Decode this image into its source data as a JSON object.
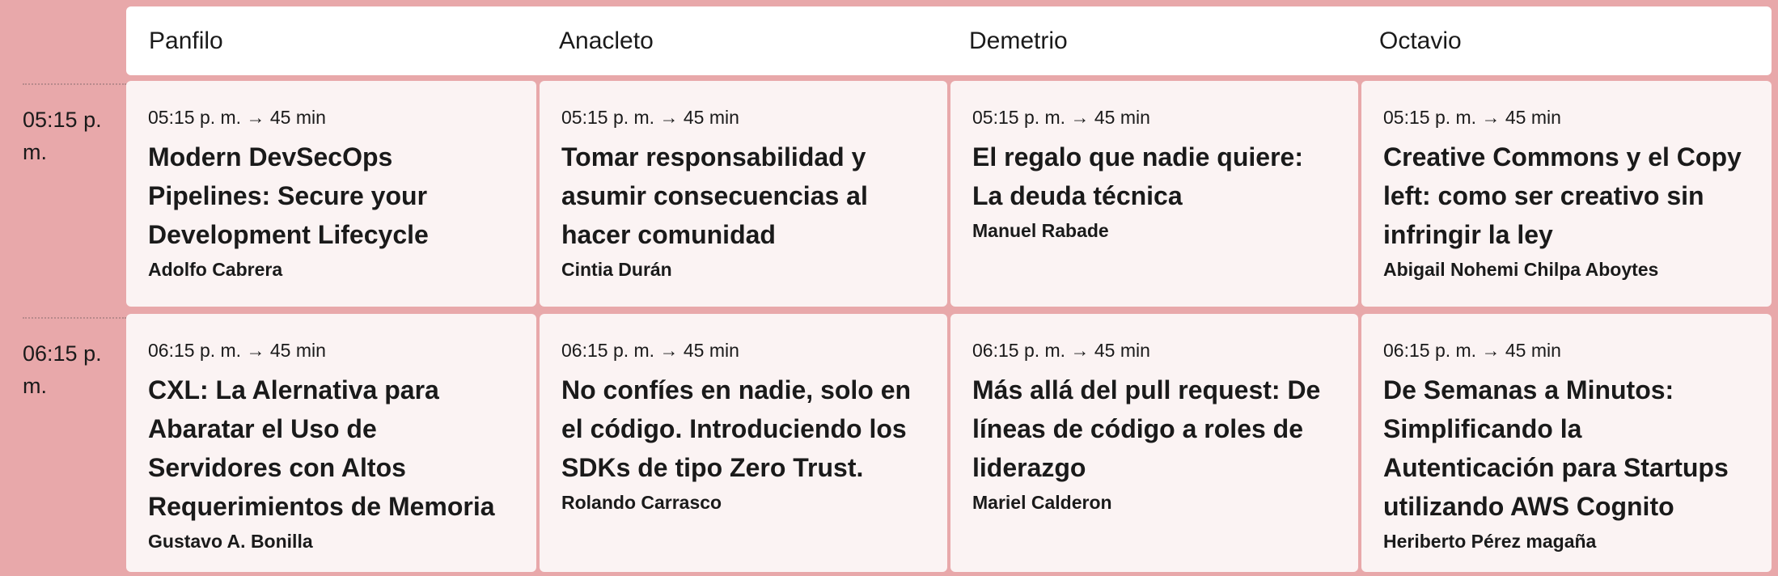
{
  "rooms": [
    "Panfilo",
    "Anacleto",
    "Demetrio",
    "Octavio"
  ],
  "slots": [
    {
      "time": "05:15 p. m.",
      "sessions": [
        {
          "time_duration": "05:15 p. m. → 45 min",
          "title": "Modern DevSecOps Pipelines: Secure your Development Lifecycle",
          "speaker": "Adolfo Cabrera"
        },
        {
          "time_duration": "05:15 p. m. → 45 min",
          "title": "Tomar responsabilidad y asumir consecuencias al hacer comunidad",
          "speaker": "Cintia Durán"
        },
        {
          "time_duration": "05:15 p. m. → 45 min",
          "title": "El regalo que nadie quiere: La deuda técnica",
          "speaker": "Manuel Rabade"
        },
        {
          "time_duration": "05:15 p. m. → 45 min",
          "title": "Creative Commons y el Copy left: como ser creativo sin infringir la ley",
          "speaker": "Abigail Nohemi Chilpa Aboytes"
        }
      ]
    },
    {
      "time": "06:15 p. m.",
      "sessions": [
        {
          "time_duration": "06:15 p. m. → 45 min",
          "title": "CXL: La Alernativa para Abaratar el Uso de Servidores con Altos Requerimientos de Memoria",
          "speaker": "Gustavo A. Bonilla"
        },
        {
          "time_duration": "06:15 p. m. → 45 min",
          "title": "No confíes en nadie, solo en el código. Introduciendo los SDKs de tipo Zero Trust.",
          "speaker": "Rolando Carrasco"
        },
        {
          "time_duration": "06:15 p. m. → 45 min",
          "title": "Más allá del pull request: De líneas de código a roles de liderazgo",
          "speaker": "Mariel Calderon"
        },
        {
          "time_duration": "06:15 p. m. → 45 min",
          "title": "De Semanas a Minutos: Simplificando la Autenticación para Startups utilizando AWS Cognito",
          "speaker": "Heriberto Pérez magaña"
        }
      ]
    }
  ]
}
